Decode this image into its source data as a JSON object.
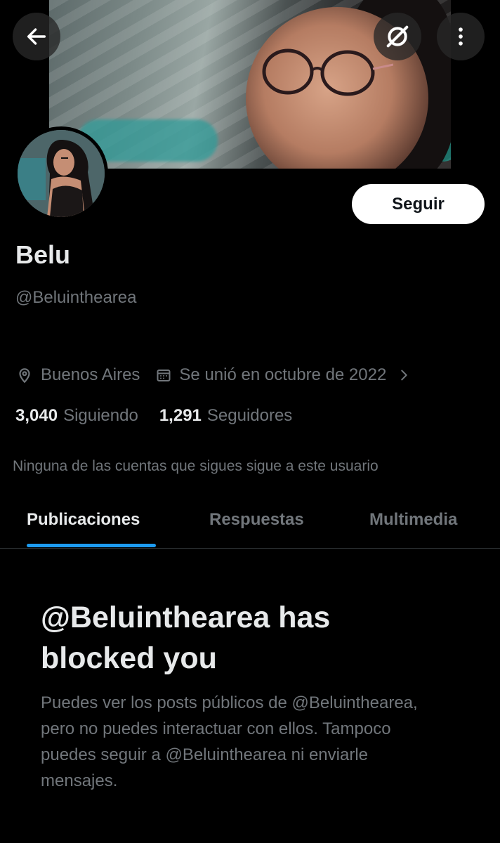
{
  "header": {
    "back_icon": "arrow-left-icon",
    "grok_icon": "slashed-circle-icon",
    "more_icon": "more-vertical-icon"
  },
  "profile": {
    "name": "Belu",
    "handle": "@Beluinthearea",
    "follow_label": "Seguir",
    "location": "Buenos Aires",
    "joined": "Se unió en octubre de 2022",
    "following_count": "3,040",
    "following_label": "Siguiendo",
    "followers_count": "1,291",
    "followers_label": "Seguidores",
    "mutuals_note": "Ninguna de las cuentas que sigues sigue a este usuario"
  },
  "tabs": [
    {
      "label": "Publicaciones",
      "active": true
    },
    {
      "label": "Respuestas",
      "active": false
    },
    {
      "label": "Multimedia",
      "active": false
    }
  ],
  "blocked": {
    "title": "@Beluinthearea has blocked you",
    "description": "Puedes ver los posts públicos de @Beluinthearea, pero no puedes interactuar con ellos. Tampoco puedes seguir a @Beluinthearea ni enviarle mensajes."
  },
  "colors": {
    "background": "#000000",
    "primary_text": "#e7e9ea",
    "secondary_text": "#71767b",
    "accent": "#1d9bf0",
    "divider": "#2f3336"
  }
}
